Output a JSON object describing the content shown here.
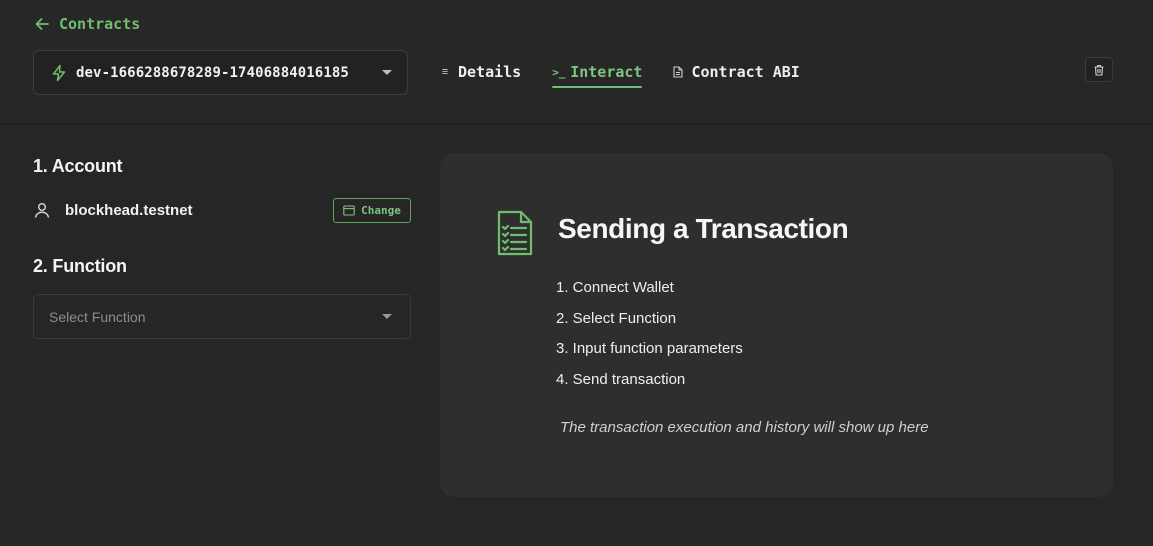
{
  "header": {
    "back_label": "Contracts",
    "contract_selector": {
      "value": "dev-1666288678289-17406884016185"
    },
    "tabs": [
      {
        "label": "Details",
        "icon": "list-icon",
        "active": false
      },
      {
        "label": "Interact",
        "icon": "terminal-icon",
        "active": true
      },
      {
        "label": "Contract ABI",
        "icon": "file-icon",
        "active": false
      }
    ],
    "delete_icon": "trash-icon"
  },
  "sidebar": {
    "account_title": "1. Account",
    "account_name": "blockhead.testnet",
    "change_label": "Change",
    "function_title": "2. Function",
    "function_placeholder": "Select Function"
  },
  "panel": {
    "title": "Sending a Transaction",
    "steps": [
      "1. Connect Wallet",
      "2. Select Function",
      "3. Input function parameters",
      "4. Send transaction"
    ],
    "note": "The transaction execution and history will show up here"
  },
  "colors": {
    "accent": "#6fbd6f",
    "background": "#262626",
    "panel": "#2e2e2e",
    "border": "#3b3b3b"
  }
}
